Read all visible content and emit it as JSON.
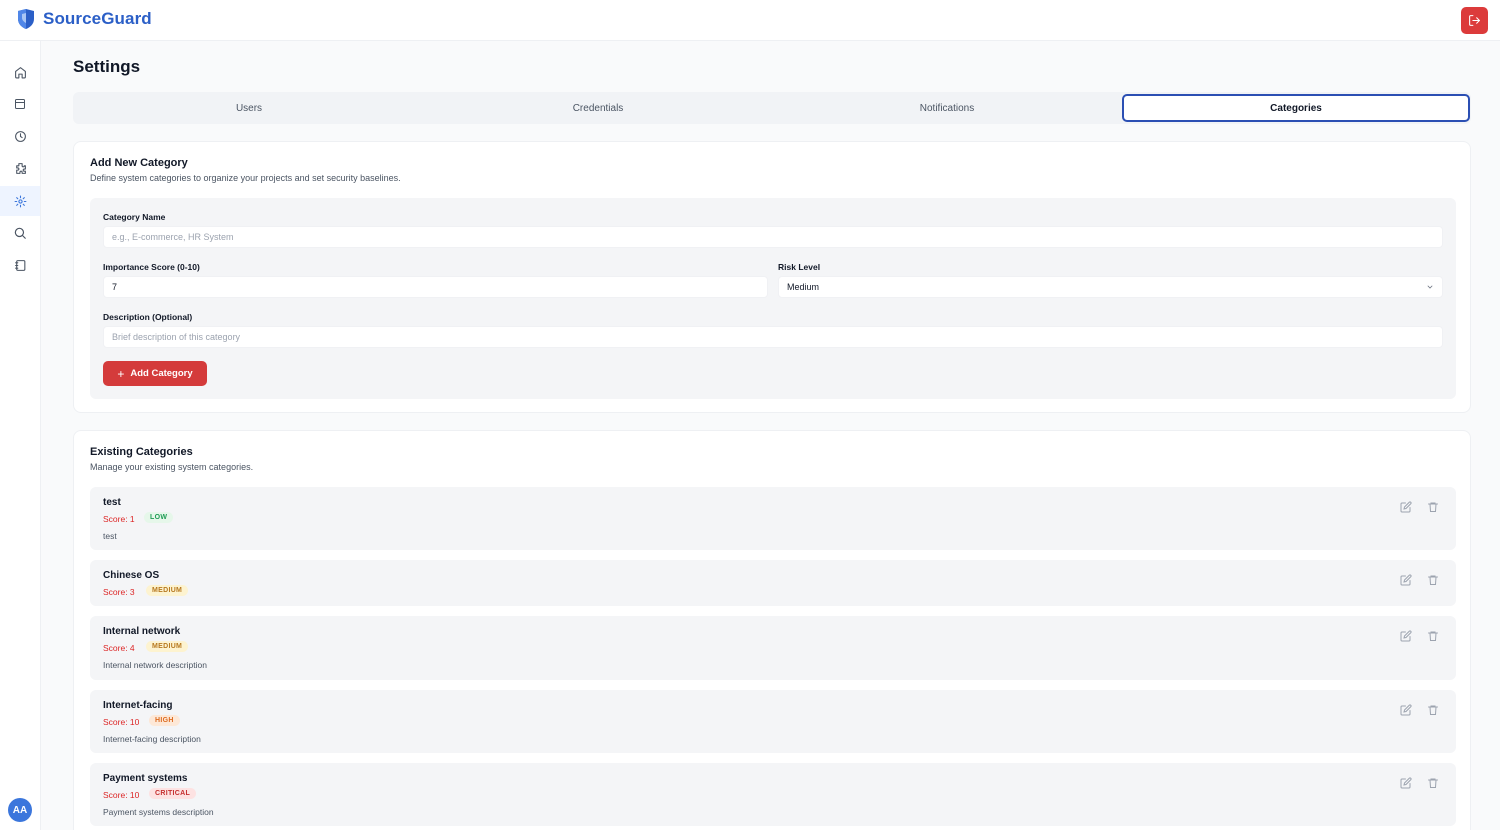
{
  "app": {
    "name": "SourceGuard"
  },
  "page": {
    "title": "Settings"
  },
  "tabs": [
    {
      "label": "Users"
    },
    {
      "label": "Credentials"
    },
    {
      "label": "Notifications"
    },
    {
      "label": "Categories"
    }
  ],
  "active_tab": "Categories",
  "add_card": {
    "title": "Add New Category",
    "subtitle": "Define system categories to organize your projects and set security baselines.",
    "category_name_label": "Category Name",
    "category_name_placeholder": "e.g., E-commerce, HR System",
    "importance_label": "Importance Score (0-10)",
    "importance_value": "7",
    "risk_label": "Risk Level",
    "risk_value": "Medium",
    "description_label": "Description (Optional)",
    "description_placeholder": "Brief description of this category",
    "add_button": "Add Category"
  },
  "existing_card": {
    "title": "Existing Categories",
    "subtitle": "Manage your existing system categories.",
    "items": [
      {
        "name": "test",
        "score": "Score: 1",
        "risk": "LOW",
        "risk_class": "low",
        "description": "test"
      },
      {
        "name": "Chinese OS",
        "score": "Score: 3",
        "risk": "MEDIUM",
        "risk_class": "medium",
        "description": ""
      },
      {
        "name": "Internal network",
        "score": "Score: 4",
        "risk": "MEDIUM",
        "risk_class": "medium",
        "description": "Internal network description"
      },
      {
        "name": "Internet-facing",
        "score": "Score: 10",
        "risk": "HIGH",
        "risk_class": "high",
        "description": "Internet-facing description"
      },
      {
        "name": "Payment systems",
        "score": "Score: 10",
        "risk": "CRITICAL",
        "risk_class": "critical",
        "description": "Payment systems description"
      }
    ]
  },
  "user": {
    "initials": "AA"
  },
  "sidebar_icons": [
    "home-icon",
    "layout-icon",
    "clock-icon",
    "puzzle-icon",
    "settings-icon",
    "search-icon",
    "notebook-icon"
  ],
  "colors": {
    "brand": "#2b5fc7",
    "accent_red": "#d43b3b",
    "active_tab_border": "#2b4fb3"
  }
}
